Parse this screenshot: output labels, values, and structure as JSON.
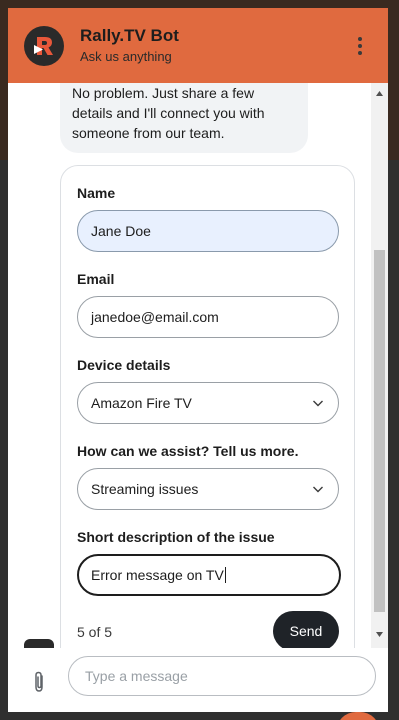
{
  "header": {
    "bot_name": "Rally.TV Bot",
    "subtitle": "Ask us anything"
  },
  "message": {
    "text": "No problem. Just share a few details and I'll connect you with someone from our team."
  },
  "form": {
    "fields": [
      {
        "label": "Name",
        "value": "Jane Doe",
        "type": "text"
      },
      {
        "label": "Email",
        "value": "janedoe@email.com",
        "type": "text"
      },
      {
        "label": "Device details",
        "value": "Amazon Fire TV",
        "type": "select"
      },
      {
        "label": "How can we assist? Tell us more.",
        "value": "Streaming issues",
        "type": "select"
      },
      {
        "label": "Short description of the issue",
        "value": "Error message on TV",
        "type": "text"
      }
    ],
    "step": "5 of 5",
    "send_label": "Send"
  },
  "composer": {
    "placeholder": "Type a message"
  },
  "colors": {
    "brand": "#e06a3f",
    "button": "#1f2328",
    "active_field": "#e8f0fe"
  }
}
